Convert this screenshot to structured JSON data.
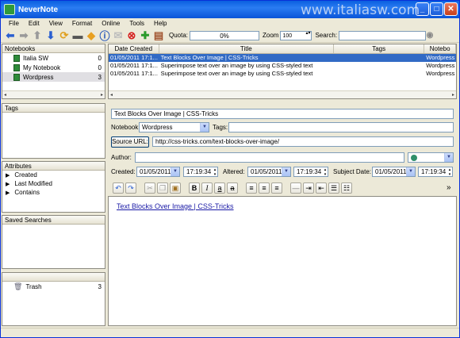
{
  "window": {
    "title": "NeverNote",
    "watermark": "www.italiasw.com"
  },
  "menu": [
    "File",
    "Edit",
    "View",
    "Format",
    "Online",
    "Tools",
    "Help"
  ],
  "toolbar": {
    "quota_label": "Quota:",
    "quota_value": "0%",
    "zoom_label": "Zoom",
    "zoom_value": "100",
    "search_label": "Search:",
    "search_value": ""
  },
  "notebooks": {
    "header": "Notebooks",
    "items": [
      {
        "name": "Italia SW",
        "count": "0"
      },
      {
        "name": "My Notebook",
        "count": "0"
      },
      {
        "name": "Wordpress",
        "count": "3"
      }
    ]
  },
  "tags": {
    "header": "Tags"
  },
  "attributes": {
    "header": "Attributes",
    "items": [
      "Created",
      "Last Modified",
      "Contains"
    ]
  },
  "saved_searches": {
    "header": "Saved Searches"
  },
  "trash": {
    "name": "Trash",
    "count": "3"
  },
  "note_list": {
    "columns": [
      "Date Created",
      "Title",
      "Tags",
      "Notebo"
    ],
    "rows": [
      {
        "date": "01/05/2011 17:1...",
        "title": "Text Blocks Over Image | CSS-Tricks",
        "tags": "",
        "notebook": "Wordpress"
      },
      {
        "date": "01/05/2011 17:1...",
        "title": "Superimpose text over an image by using CSS-styled text",
        "tags": "",
        "notebook": "Wordpress"
      },
      {
        "date": "01/05/2011 17:1...",
        "title": "Superimpose text over an image by using CSS-styled text",
        "tags": "",
        "notebook": "Wordpress"
      }
    ]
  },
  "editor": {
    "title_value": "Text Blocks Over Image | CSS-Tricks",
    "notebook_label": "Notebook",
    "notebook_value": "Wordpress",
    "tags_label": "Tags:",
    "source_url_button": "Source URL:",
    "source_url_value": "http://css-tricks.com/text-blocks-over-image/",
    "author_label": "Author:",
    "created_label": "Created:",
    "created_date": "01/05/2011",
    "created_time": "17:19:34",
    "altered_label": "Altered:",
    "altered_date": "01/05/2011",
    "altered_time": "17:19:34",
    "subject_label": "Subject Date:",
    "subject_date": "01/05/2011",
    "subject_time": "17:19:34",
    "body_link": "Text Blocks Over Image | CSS-Tricks",
    "more_glyph": "»"
  },
  "format_buttons": {
    "bold": "B",
    "italic": "I",
    "underline": "a",
    "strike": "a"
  }
}
